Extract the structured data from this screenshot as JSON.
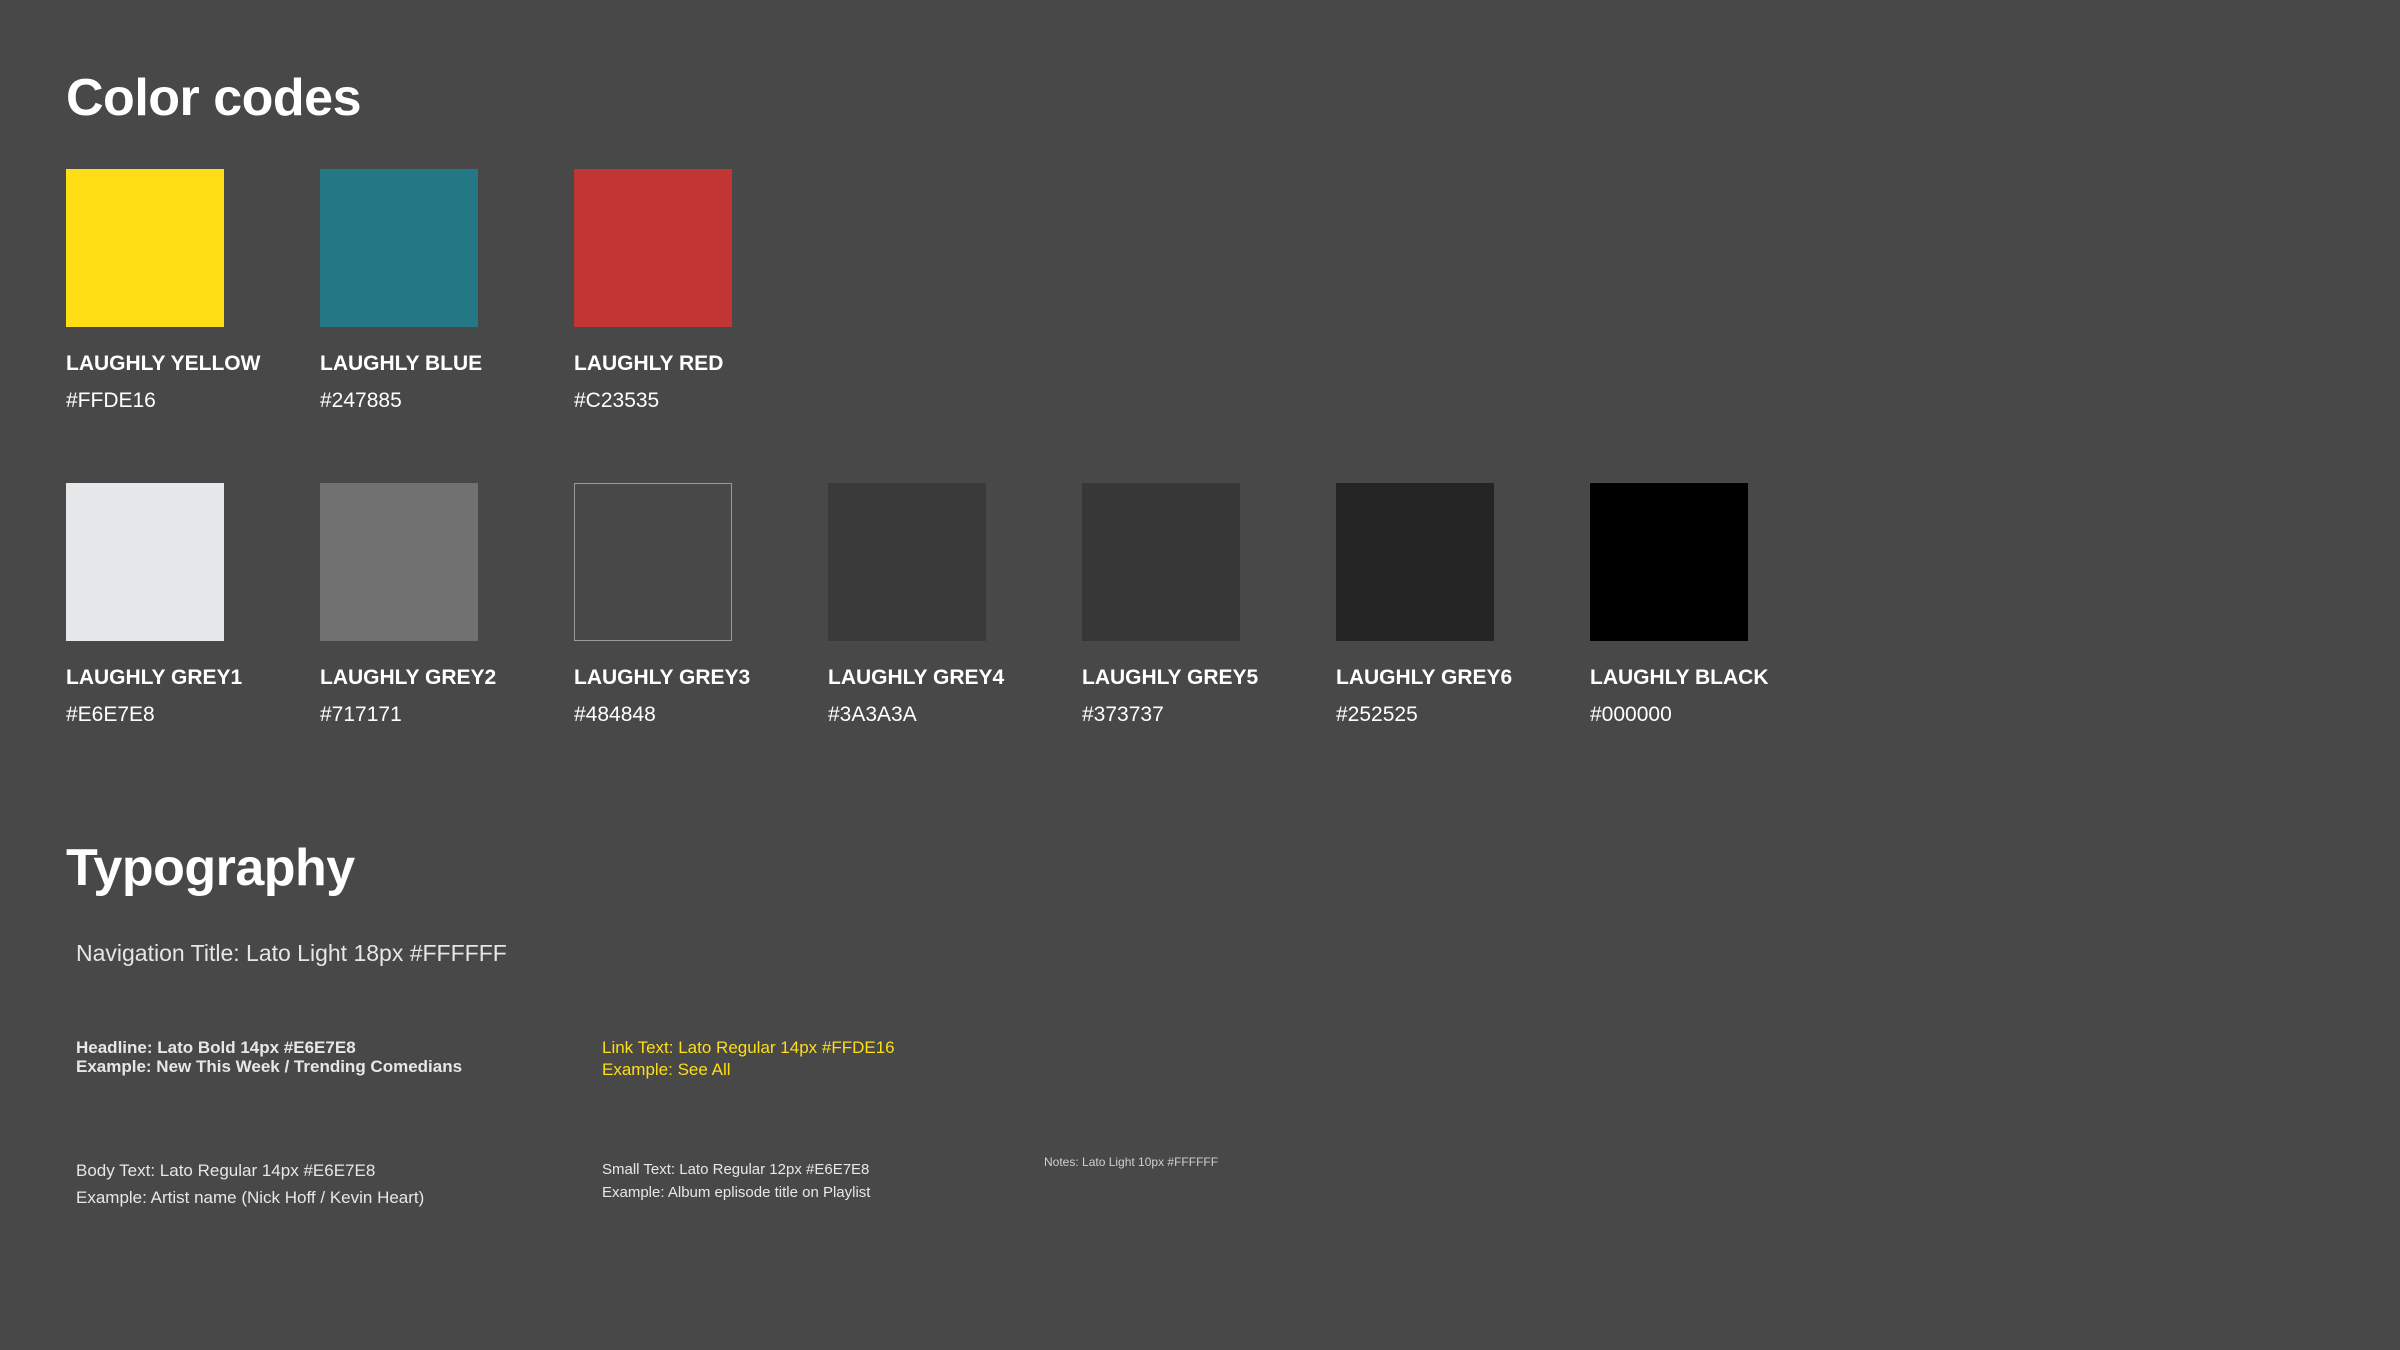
{
  "colors_section": {
    "title": "Color codes",
    "primary": [
      {
        "name": "LAUGHLY YELLOW",
        "hex": "#FFDE16",
        "color": "#FFDE16"
      },
      {
        "name": "LAUGHLY BLUE",
        "hex": "#247885",
        "color": "#247885"
      },
      {
        "name": "LAUGHLY RED",
        "hex": "#C23535",
        "color": "#C23535"
      }
    ],
    "greys": [
      {
        "name": "LAUGHLY GREY1",
        "hex": "#E6E7E8",
        "color": "#E6E7E8"
      },
      {
        "name": "LAUGHLY GREY2",
        "hex": "#717171",
        "color": "#717171"
      },
      {
        "name": "LAUGHLY GREY3",
        "hex": "#484848",
        "color": "#484848"
      },
      {
        "name": "LAUGHLY GREY4",
        "hex": "#3A3A3A",
        "color": "#3A3A3A"
      },
      {
        "name": "LAUGHLY GREY5",
        "hex": "#373737",
        "color": "#373737"
      },
      {
        "name": "LAUGHLY GREY6",
        "hex": "#252525",
        "color": "#252525"
      },
      {
        "name": "LAUGHLY BLACK",
        "hex": "#000000",
        "color": "#000000"
      }
    ]
  },
  "typography_section": {
    "title": "Typography",
    "nav_title": "Navigation Title: Lato Light 18px #FFFFFF",
    "headline": {
      "line1": "Headline: Lato Bold 14px #E6E7E8",
      "line2": "Example: New This Week / Trending Comedians"
    },
    "link_text": {
      "line1": "Link Text: Lato Regular 14px #FFDE16",
      "line2": "Example: See All"
    },
    "body_text": {
      "line1": "Body Text: Lato Regular 14px #E6E7E8",
      "line2": "Example: Artist name (Nick Hoff / Kevin Heart)"
    },
    "small_text": {
      "line1": "Small Text: Lato Regular 12px #E6E7E8",
      "line2": "Example: Album eplisode title on Playlist"
    },
    "notes": "Notes: Lato Light 10px #FFFFFF"
  }
}
